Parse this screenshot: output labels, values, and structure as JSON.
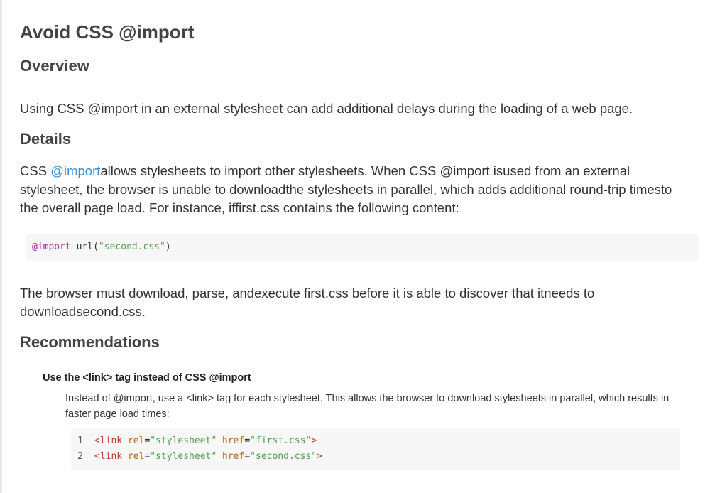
{
  "title": "Avoid CSS @import",
  "overview": {
    "heading": "Overview",
    "text": "Using CSS @import in an external stylesheet can add additional delays during the loading of a web page."
  },
  "details": {
    "heading": "Details",
    "prefix": "CSS ",
    "link": "@import",
    "text": "allows stylesheets to import other stylesheets. When CSS @import isused from an external stylesheet, the browser is unable to downloadthe stylesheets in parallel, which adds additional round-trip timesto the overall page load. For instance, iffirst.css contains the following content:",
    "code": {
      "keyword": "@import",
      "func": " url(",
      "string": "\"second.css\"",
      "close": ")"
    },
    "after": "The browser must download, parse, andexecute first.css before it is able to discover that itneeds to downloadsecond.css."
  },
  "recommendations": {
    "heading": "Recommendations",
    "item_title": "Use the <link> tag instead of CSS @import",
    "item_text": "Instead of @import, use a <link> tag for each stylesheet. This allows the browser to download stylesheets in parallel, which results in faster page load times:",
    "code_lines": [
      {
        "num": "1",
        "open": "<link",
        "attr1": " rel",
        "eq1": "=",
        "val1": "\"stylesheet\"",
        "attr2": " href",
        "eq2": "=",
        "val2": "\"first.css\"",
        "close": ">"
      },
      {
        "num": "2",
        "open": "<link",
        "attr1": " rel",
        "eq1": "=",
        "val1": "\"stylesheet\"",
        "attr2": " href",
        "eq2": "=",
        "val2": "\"second.css\"",
        "close": ">"
      }
    ]
  },
  "colors": {
    "link": "#3b8ed6",
    "code_background": "#f7f7f8",
    "keyword": "#a626a4",
    "string": "#50a14f",
    "tag": "#c0392b",
    "attribute": "#b5651d"
  }
}
